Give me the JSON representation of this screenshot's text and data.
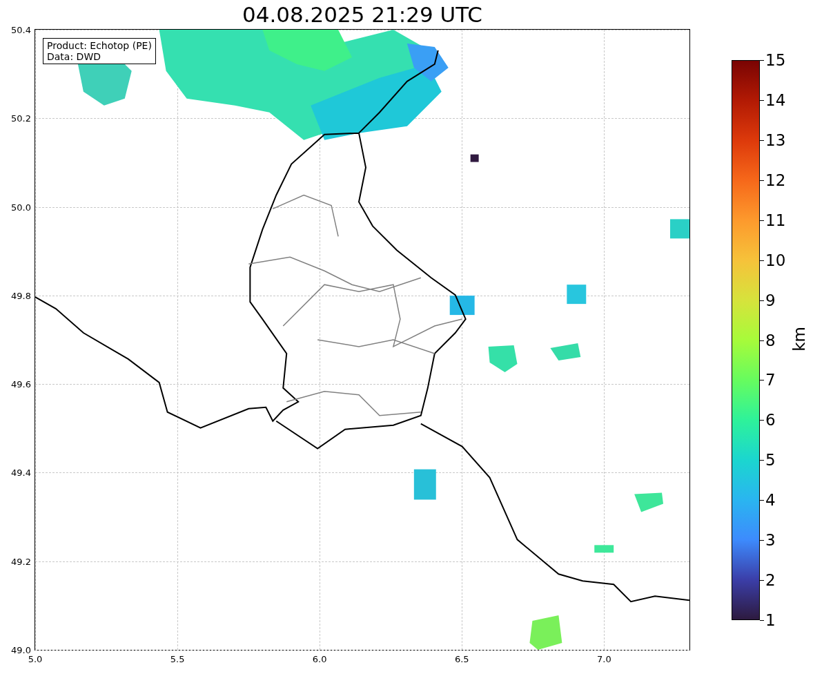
{
  "title": "04.08.2025 21:29 UTC",
  "map": {
    "legend": [
      "Product: Echotop (PE)",
      "Data: DWD"
    ],
    "x_ticks": [
      "5.0",
      "5.5",
      "6.0",
      "6.5",
      "7.0"
    ],
    "y_ticks": [
      "50.4",
      "50.2",
      "50.0",
      "49.8",
      "49.6",
      "49.4",
      "49.2",
      "49.0"
    ]
  },
  "colorbar": {
    "label": "km",
    "ticks": [
      "15",
      "14",
      "13",
      "12",
      "11",
      "10",
      "9",
      "8",
      "7",
      "6",
      "5",
      "4",
      "3",
      "2",
      "1"
    ]
  }
}
